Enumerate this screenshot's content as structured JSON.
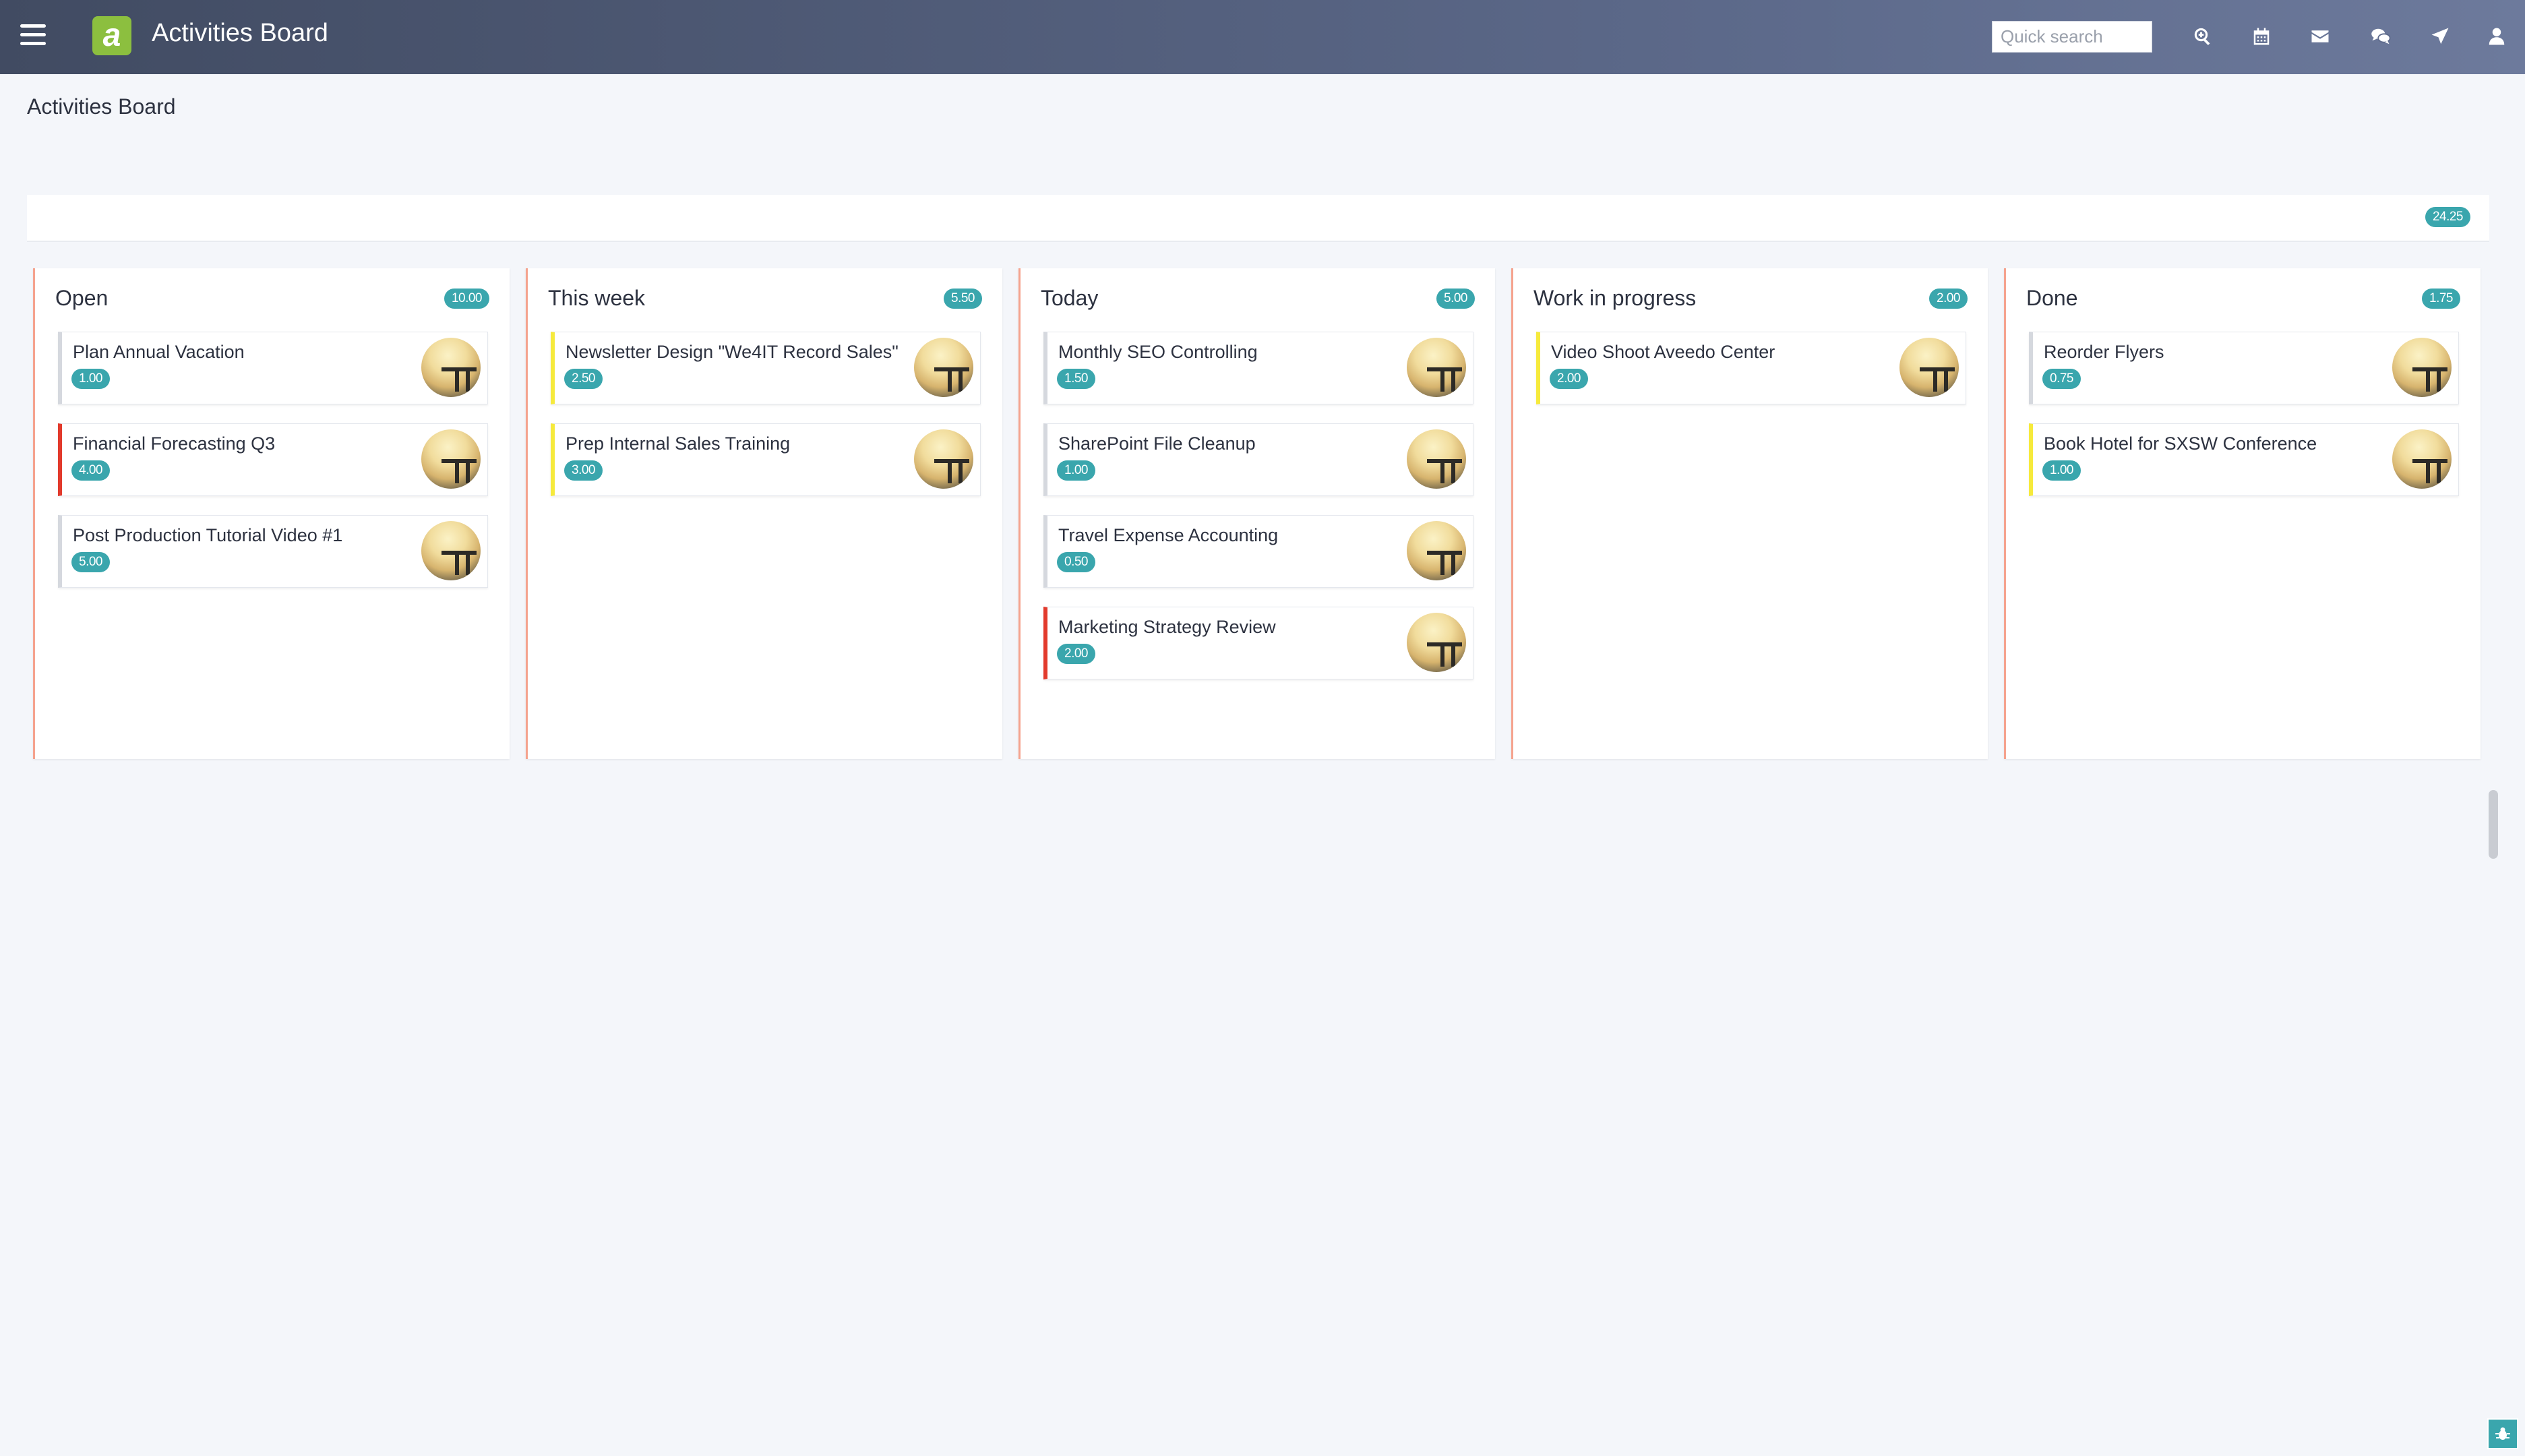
{
  "header": {
    "logo_letter": "a",
    "title": "Activities Board",
    "search_placeholder": "Quick search",
    "icons": [
      "search-icon",
      "calendar-icon",
      "mail-icon",
      "chat-icon",
      "rocket-icon",
      "user-icon"
    ]
  },
  "page": {
    "title": "Activities Board"
  },
  "summary": {
    "total": "24.25"
  },
  "columns": [
    {
      "title": "Open",
      "total": "10.00",
      "cards": [
        {
          "title": "Plan Annual Vacation",
          "hours": "1.00",
          "flag": "none"
        },
        {
          "title": "Financial Forecasting Q3",
          "hours": "4.00",
          "flag": "red"
        },
        {
          "title": "Post Production Tutorial Video #1",
          "hours": "5.00",
          "flag": "none"
        }
      ]
    },
    {
      "title": "This week",
      "total": "5.50",
      "cards": [
        {
          "title": "Newsletter Design \"We4IT Record Sales\"",
          "hours": "2.50",
          "flag": "yellow"
        },
        {
          "title": "Prep Internal Sales Training",
          "hours": "3.00",
          "flag": "yellow"
        }
      ]
    },
    {
      "title": "Today",
      "total": "5.00",
      "cards": [
        {
          "title": "Monthly SEO Controlling",
          "hours": "1.50",
          "flag": "none"
        },
        {
          "title": "SharePoint File Cleanup",
          "hours": "1.00",
          "flag": "none"
        },
        {
          "title": "Travel Expense Accounting",
          "hours": "0.50",
          "flag": "none"
        },
        {
          "title": "Marketing Strategy Review",
          "hours": "2.00",
          "flag": "red"
        }
      ]
    },
    {
      "title": "Work in progress",
      "total": "2.00",
      "cards": [
        {
          "title": "Video Shoot Aveedo Center",
          "hours": "2.00",
          "flag": "yellow"
        }
      ]
    },
    {
      "title": "Done",
      "total": "1.75",
      "cards": [
        {
          "title": "Reorder Flyers",
          "hours": "0.75",
          "flag": "none"
        },
        {
          "title": "Book Hotel for SXSW Conference",
          "hours": "1.00",
          "flag": "yellow"
        }
      ]
    }
  ],
  "colors": {
    "accent": "#3aa6ad",
    "flag_red": "#e23a2c",
    "flag_yellow": "#f6ea3c",
    "column_border": "#f5a38e"
  }
}
